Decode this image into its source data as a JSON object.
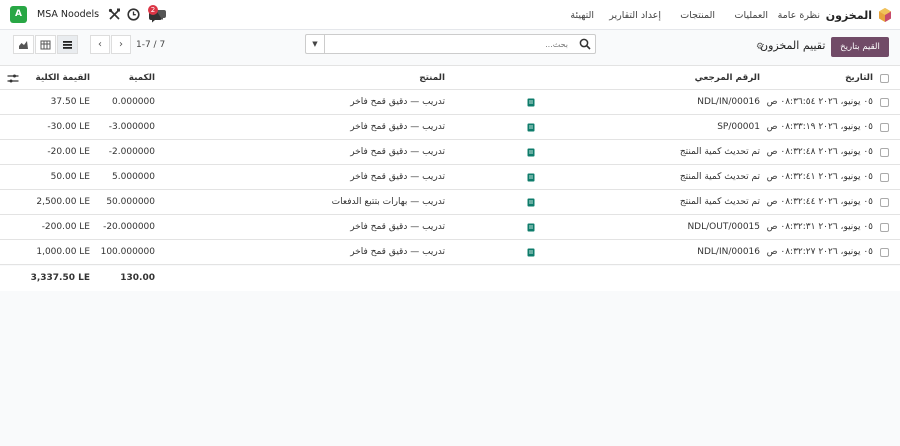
{
  "nav": {
    "app_name": "المخزون",
    "menu": [
      "نظرة عامة",
      "العمليات",
      "المنتجات",
      "إعداد التقارير",
      "التهيئة"
    ],
    "avatar_letter": "A",
    "company": "MSA Noodels",
    "notification_count": "2"
  },
  "control": {
    "primary_button": "القيم بتاريخ",
    "page_title": "تقييم المخزون",
    "search_placeholder": "بحث...",
    "pager": "1-7 / 7"
  },
  "table": {
    "headers": {
      "date": "التاريخ",
      "reference": "الرقم المرجعي",
      "product": "المنتج",
      "quantity": "الكمية",
      "total_value": "القيمة الكلية"
    },
    "rows": [
      {
        "date": "٠٥ يونيو، ٢٠٢٦ ٠٨:٣٦:٥٤ ص",
        "reference": "NDL/IN/00016",
        "has_doc": true,
        "product": "تدريب — دقيق قمح فاخر",
        "quantity": "0.000000",
        "value": "37.50 LE"
      },
      {
        "date": "٠٥ يونيو، ٢٠٢٦ ٠٨:٣٣:١٩ ص",
        "reference": "SP/00001",
        "has_doc": true,
        "product": "تدريب — دقيق قمح فاخر",
        "quantity": "-3.000000",
        "value": "-30.00 LE"
      },
      {
        "date": "٠٥ يونيو، ٢٠٢٦ ٠٨:٣٢:٤٨ ص",
        "reference": "تم تحديث كمية المنتج",
        "has_doc": true,
        "product": "تدريب — دقيق قمح فاخر",
        "quantity": "-2.000000",
        "value": "-20.00 LE"
      },
      {
        "date": "٠٥ يونيو، ٢٠٢٦ ٠٨:٣٢:٤١ ص",
        "reference": "تم تحديث كمية المنتج",
        "has_doc": true,
        "product": "تدريب — دقيق قمح فاخر",
        "quantity": "5.000000",
        "value": "50.00 LE"
      },
      {
        "date": "٠٥ يونيو، ٢٠٢٦ ٠٨:٣٢:٤٤ ص",
        "reference": "تم تحديث كمية المنتج",
        "has_doc": true,
        "product": "تدريب — بهارات بتتبع الدفعات",
        "quantity": "50.000000",
        "value": "2,500.00 LE"
      },
      {
        "date": "٠٥ يونيو، ٢٠٢٦ ٠٨:٣٢:٣١ ص",
        "reference": "NDL/OUT/00015",
        "has_doc": true,
        "product": "تدريب — دقيق قمح فاخر",
        "quantity": "-20.000000",
        "value": "-200.00 LE"
      },
      {
        "date": "٠٥ يونيو، ٢٠٢٦ ٠٨:٣٢:٢٧ ص",
        "reference": "NDL/IN/00016",
        "has_doc": true,
        "product": "تدريب — دقيق قمح فاخر",
        "quantity": "100.000000",
        "value": "1,000.00 LE"
      }
    ],
    "totals": {
      "quantity": "130.00",
      "value": "3,337.50 LE"
    }
  },
  "colors": {
    "brand": "#714b67",
    "avatar": "#28a745",
    "doc_icon": "#0e7c6b",
    "badge": "#dc3545"
  }
}
